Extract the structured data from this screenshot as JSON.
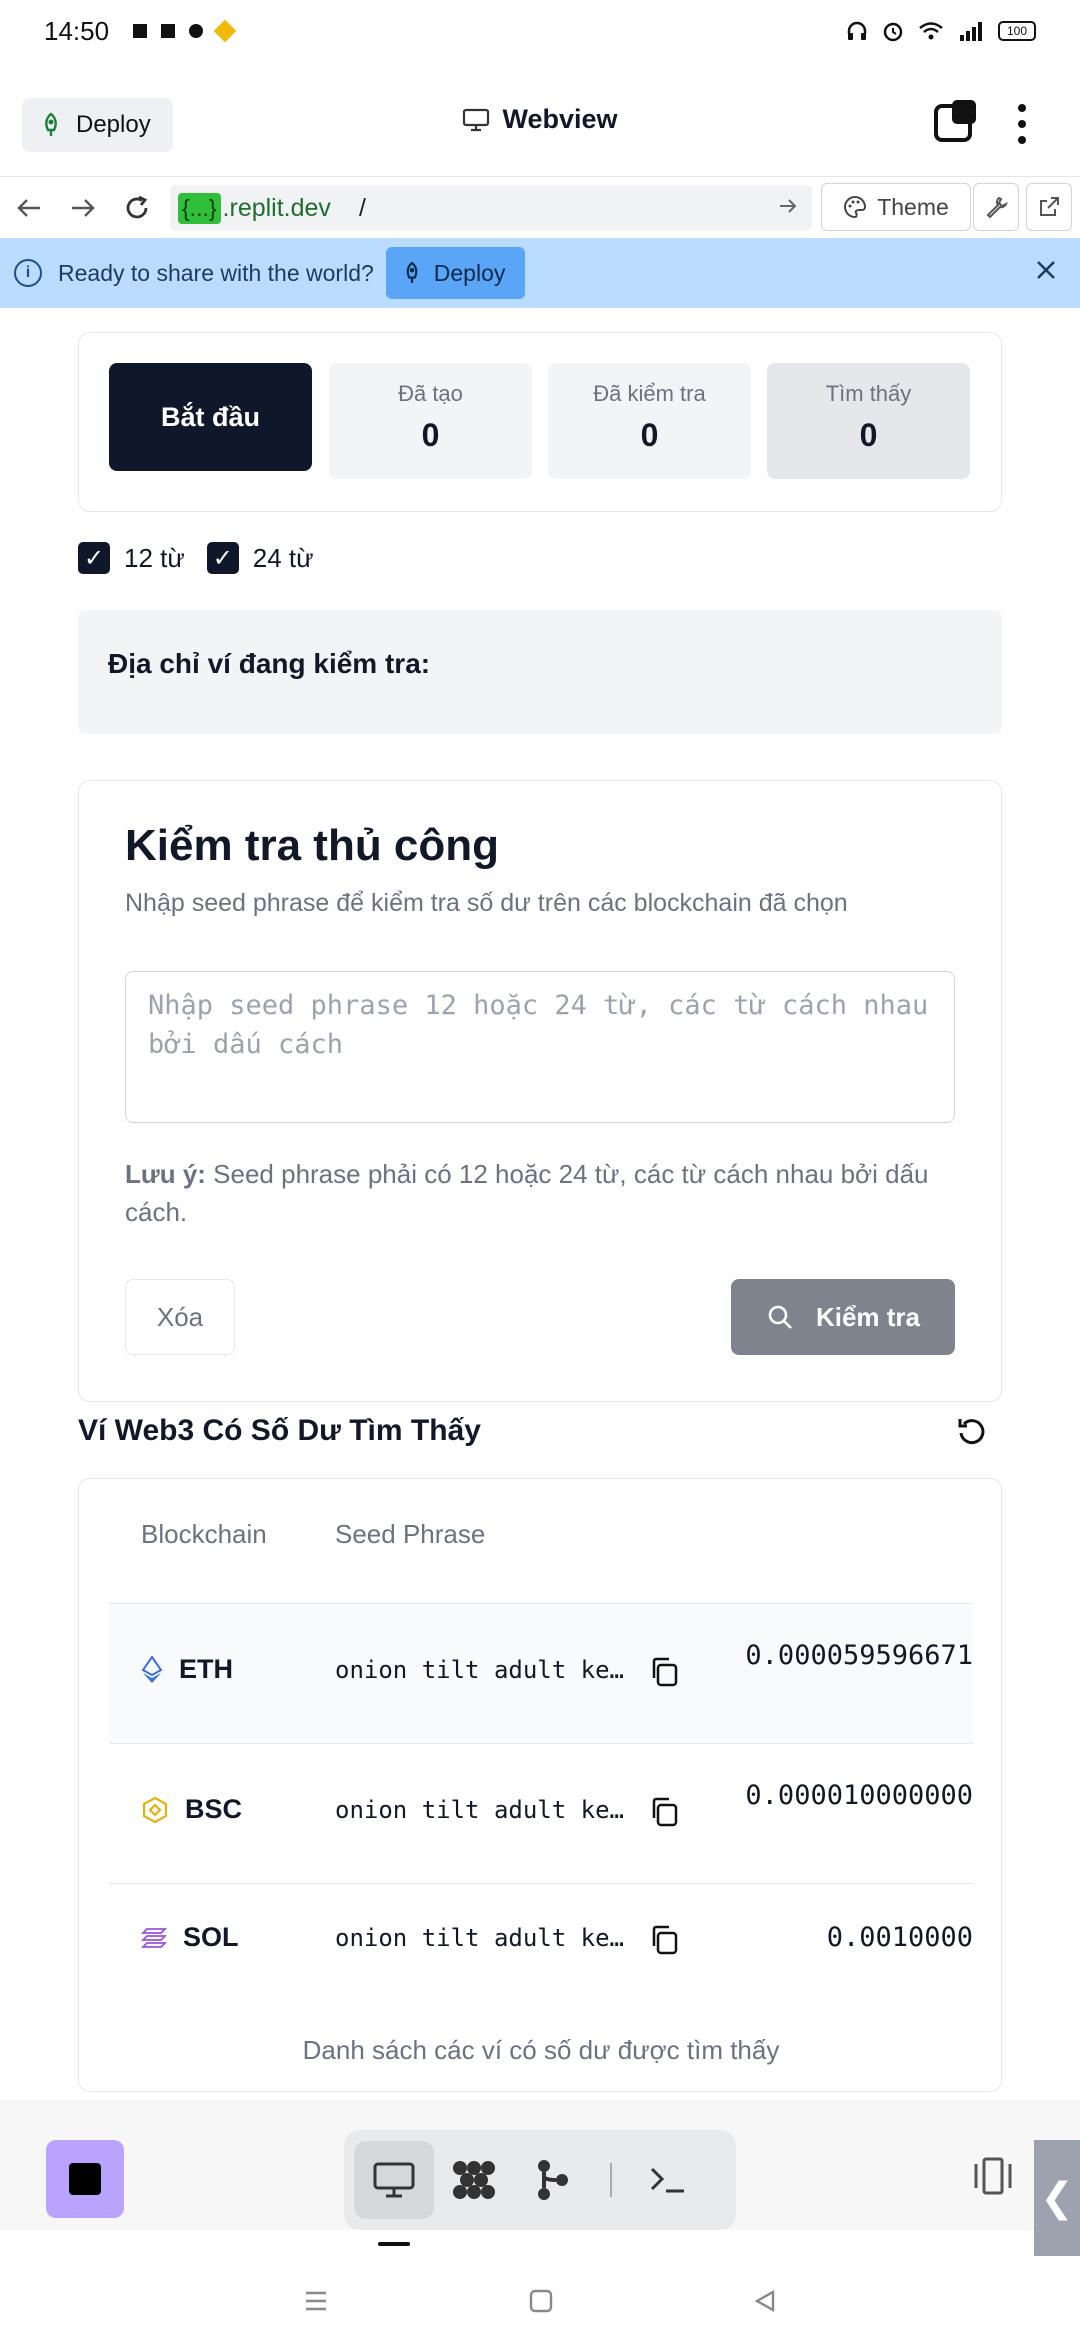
{
  "status_bar": {
    "time": "14:50",
    "battery": "100"
  },
  "header": {
    "deploy_label": "Deploy",
    "title": "Webview"
  },
  "url_bar": {
    "domain_badge": "{...}",
    "domain": ".replit.dev",
    "path": "/",
    "theme_label": "Theme"
  },
  "banner": {
    "message": "Ready to share with the world?",
    "deploy_label": "Deploy"
  },
  "stats": {
    "start_label": "Bắt đầu",
    "generated_label": "Đã tạo",
    "generated_value": "0",
    "checked_label": "Đã kiểm tra",
    "checked_value": "0",
    "found_label": "Tìm thấy",
    "found_value": "0"
  },
  "options": {
    "opt12_label": "12 từ",
    "opt12_checked": true,
    "opt24_label": "24 từ",
    "opt24_checked": true
  },
  "address_box": {
    "label": "Địa chỉ ví đang kiểm tra:"
  },
  "manual": {
    "title": "Kiểm tra thủ công",
    "description": "Nhập seed phrase để kiểm tra số dư trên các blockchain đã chọn",
    "placeholder": "Nhập seed phrase 12 hoặc 24 từ, các từ cách nhau bởi dấu cách",
    "note_bold": "Lưu ý:",
    "note_text": " Seed phrase phải có 12 hoặc 24 từ, các từ cách nhau bởi dấu cách.",
    "clear_label": "Xóa",
    "check_label": "Kiểm tra"
  },
  "found": {
    "title": "Ví Web3 Có Số Dư Tìm Thấy",
    "columns": [
      "Blockchain",
      "Seed Phrase"
    ],
    "rows": [
      {
        "chain": "ETH",
        "seed": "onion tilt adult ke…",
        "balance": "0.000059596671"
      },
      {
        "chain": "BSC",
        "seed": "onion tilt adult ke…",
        "balance": "0.000010000000"
      },
      {
        "chain": "SOL",
        "seed": "onion tilt adult ke…",
        "balance": "0.0010000"
      }
    ],
    "caption": "Danh sách các ví có số dư được tìm thấy"
  },
  "colors": {
    "banner_bg": "#b9dcff",
    "primary_dark": "#0f172a",
    "check_button": "#7d848e",
    "stop_button": "#b9a3ff"
  }
}
